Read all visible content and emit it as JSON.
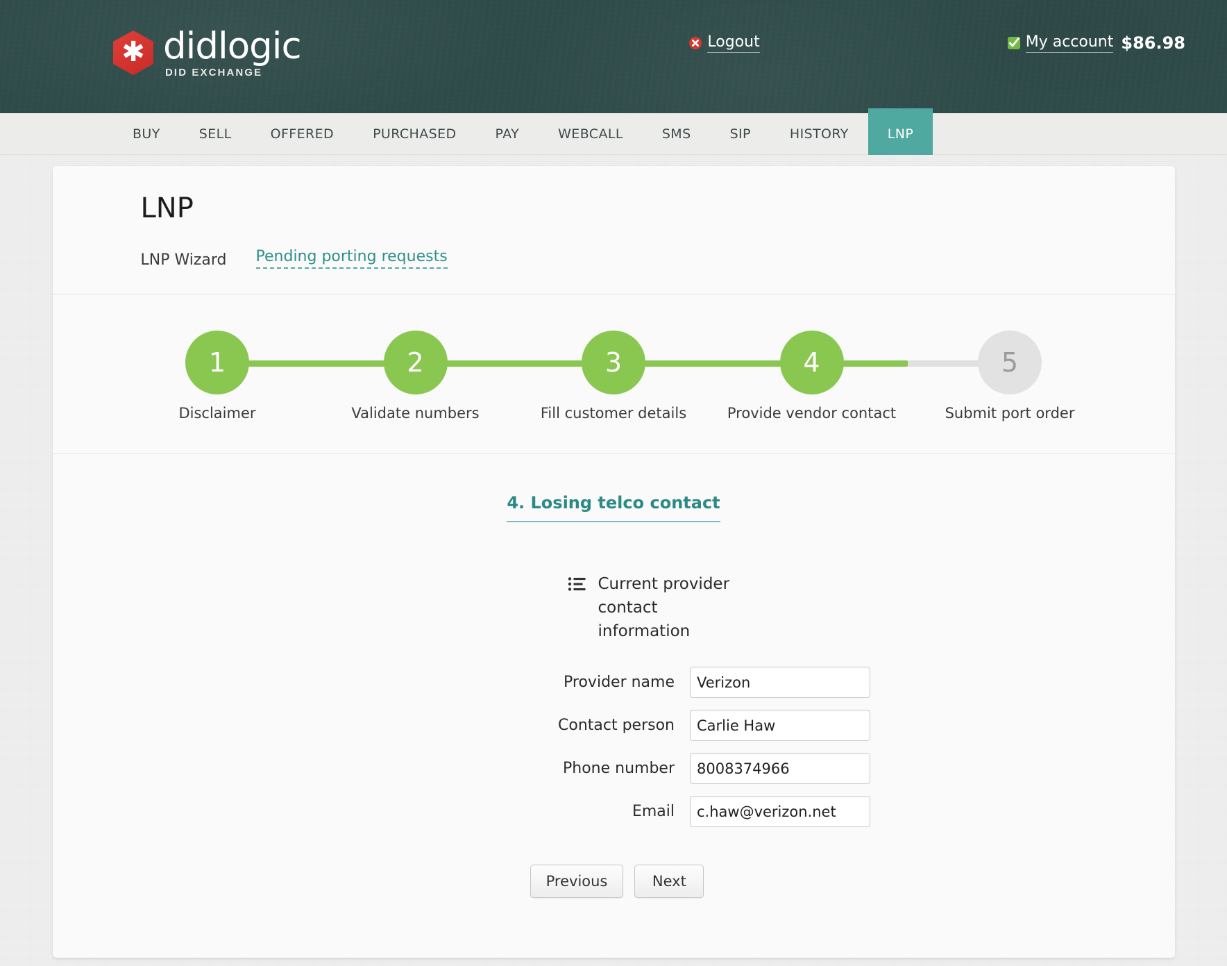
{
  "header": {
    "logo_name": "didlogic",
    "logo_tagline": "DID EXCHANGE",
    "logo_icon": "asterisk-hex-icon",
    "account_check_icon": "green-check-icon",
    "account_label": "My account",
    "account_balance": "$86.98",
    "logout_icon": "red-x-icon",
    "logout_label": "Logout"
  },
  "nav": {
    "items": [
      {
        "label": "BUY",
        "active": false
      },
      {
        "label": "SELL",
        "active": false
      },
      {
        "label": "OFFERED",
        "active": false
      },
      {
        "label": "PURCHASED",
        "active": false
      },
      {
        "label": "PAY",
        "active": false
      },
      {
        "label": "WEBCALL",
        "active": false
      },
      {
        "label": "SMS",
        "active": false
      },
      {
        "label": "SIP",
        "active": false
      },
      {
        "label": "HISTORY",
        "active": false
      },
      {
        "label": "LNP",
        "active": true
      }
    ],
    "active_color": "#4fa9a0"
  },
  "page": {
    "title": "LNP",
    "subnav": [
      {
        "label": "LNP Wizard",
        "is_link": false
      },
      {
        "label": "Pending porting requests",
        "is_link": true
      }
    ]
  },
  "stepper": {
    "progress_fill_percent": 85,
    "completed_color": "#8ac751",
    "pending_color": "#e2e2e2",
    "steps": [
      {
        "number": "1",
        "label": "Disclaimer",
        "state": "done"
      },
      {
        "number": "2",
        "label": "Validate numbers",
        "state": "done"
      },
      {
        "number": "3",
        "label": "Fill customer details",
        "state": "done"
      },
      {
        "number": "4",
        "label": "Provide vendor contact",
        "state": "done"
      },
      {
        "number": "5",
        "label": "Submit port order",
        "state": "pending"
      }
    ]
  },
  "form": {
    "section_title": "4. Losing telco contact",
    "legend_icon": "list-icon",
    "legend_text": "Current provider contact information",
    "fields": [
      {
        "label": "Provider name",
        "value": "Verizon",
        "placeholder": ""
      },
      {
        "label": "Contact person",
        "value": "Carlie Haw",
        "placeholder": ""
      },
      {
        "label": "Phone number",
        "value": "8008374966",
        "placeholder": ""
      },
      {
        "label": "Email",
        "value": "c.haw@verizon.net",
        "placeholder": ""
      }
    ],
    "buttons": {
      "previous": "Previous",
      "next": "Next"
    }
  }
}
